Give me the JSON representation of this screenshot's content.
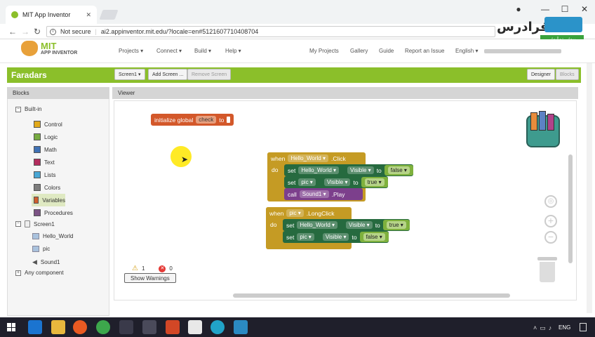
{
  "browser": {
    "tab_title": "MIT App Inventor",
    "security": "Not secure",
    "url": "ai2.appinventor.mit.edu/?locale=en#5121607710408704",
    "watermark": "فرادرس",
    "watermark_sub": "پیش نمایش"
  },
  "app": {
    "logo_line1": "MIT",
    "logo_line2": "APP INVENTOR",
    "menu": [
      "Projects ▾",
      "Connect ▾",
      "Build ▾",
      "Help ▾"
    ],
    "right_menu": [
      "My Projects",
      "Gallery",
      "Guide",
      "Report an Issue",
      "English ▾"
    ],
    "project_name": "Faradars",
    "screen_select": "Screen1 ▾",
    "add_screen": "Add Screen ...",
    "remove_screen": "Remove Screen",
    "designer": "Designer",
    "blocks": "Blocks"
  },
  "panel": {
    "blocks_title": "Blocks",
    "viewer_title": "Viewer",
    "builtin": "Built-in",
    "builtin_items": [
      {
        "label": "Control",
        "color": "#e1a91a"
      },
      {
        "label": "Logic",
        "color": "#77ab41"
      },
      {
        "label": "Math",
        "color": "#3f71b5"
      },
      {
        "label": "Text",
        "color": "#b32d5e"
      },
      {
        "label": "Lists",
        "color": "#49a6d4"
      },
      {
        "label": "Colors",
        "color": "#7d7d7d"
      },
      {
        "label": "Variables",
        "color": "#d05f2d"
      },
      {
        "label": "Procedures",
        "color": "#7c5385"
      }
    ],
    "screen": "Screen1",
    "components": [
      "Hello_World",
      "pic",
      "Sound1"
    ],
    "any_component": "Any component"
  },
  "workspace": {
    "global_block": {
      "prefix": "initialize global",
      "name": "check",
      "to": "to"
    },
    "event1": {
      "when": "when",
      "component": "Hello_World ▾",
      "event": ".Click",
      "do": "do",
      "set1": {
        "set": "set",
        "comp": "Hello_World ▾",
        "prop": "Visible ▾",
        "to": "to",
        "value": "false ▾"
      },
      "set2": {
        "set": "set",
        "comp": "pic ▾",
        "prop": "Visible ▾",
        "to": "to",
        "value": "true ▾"
      },
      "call": {
        "call": "call",
        "comp": "Sound1 ▾",
        "method": ".Play"
      }
    },
    "event2": {
      "when": "when",
      "component": "pic ▾",
      "event": ".LongClick",
      "do": "do",
      "set1": {
        "set": "set",
        "comp": "Hello_World ▾",
        "prop": "Visible ▾",
        "to": "to",
        "value": "true ▾"
      },
      "set2": {
        "set": "set",
        "comp": "pic ▾",
        "prop": "Visible ▾",
        "to": "to",
        "value": "false ▾"
      }
    },
    "warnings_count": "1",
    "errors_count": "0",
    "show_warnings": "Show Warnings"
  },
  "taskbar": {
    "lang": "ENG"
  }
}
